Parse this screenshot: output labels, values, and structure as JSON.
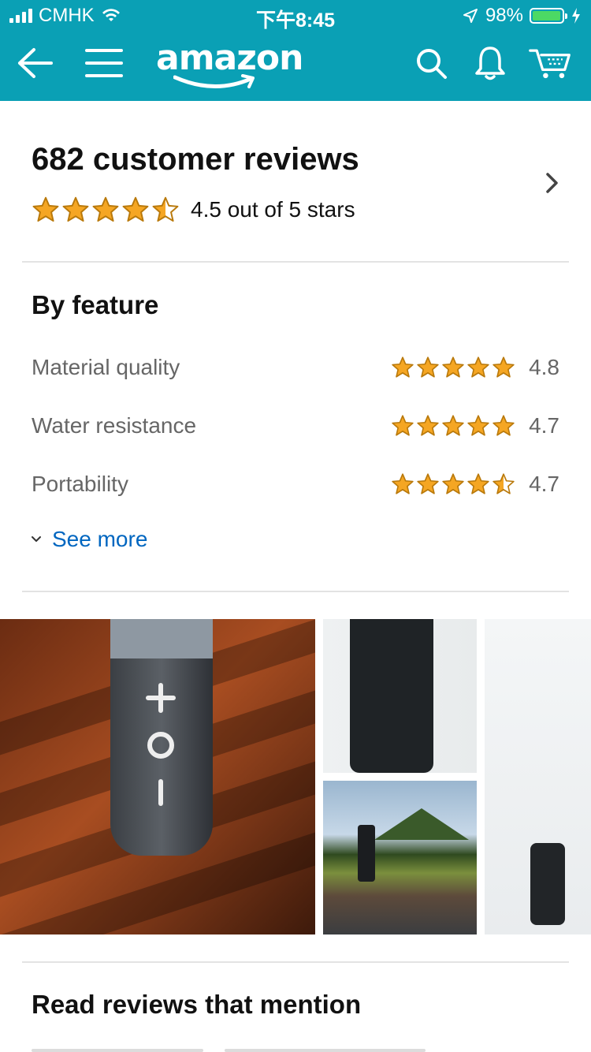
{
  "status_bar": {
    "carrier": "CMHK",
    "time": "下午8:45",
    "battery_percent": "98%",
    "battery_level": 0.98
  },
  "header": {
    "logo_text": "amazon",
    "icons": [
      "back-arrow-icon",
      "menu-icon",
      "search-icon",
      "bell-icon",
      "cart-icon"
    ],
    "brand_color": "#0aa0b5"
  },
  "reviews_summary": {
    "title": "682 customer reviews",
    "rating_text": "4.5 out of 5 stars",
    "rating": 4.5,
    "star_color": "#f5a623"
  },
  "by_feature": {
    "title": "By feature",
    "items": [
      {
        "label": "Material quality",
        "value": "4.8",
        "stars": 5
      },
      {
        "label": "Water resistance",
        "value": "4.7",
        "stars": 5
      },
      {
        "label": "Portability",
        "value": "4.7",
        "stars": 4.5
      }
    ],
    "see_more": "See more"
  },
  "images_section": {
    "tiles": [
      "customer-photo-speaker-on-table",
      "customer-photo-speaker-closeup",
      "customer-photo-speaker-outdoors",
      "customer-photo-speaker-on-wall"
    ]
  },
  "read_reviews": {
    "title": "Read reviews that mention"
  }
}
